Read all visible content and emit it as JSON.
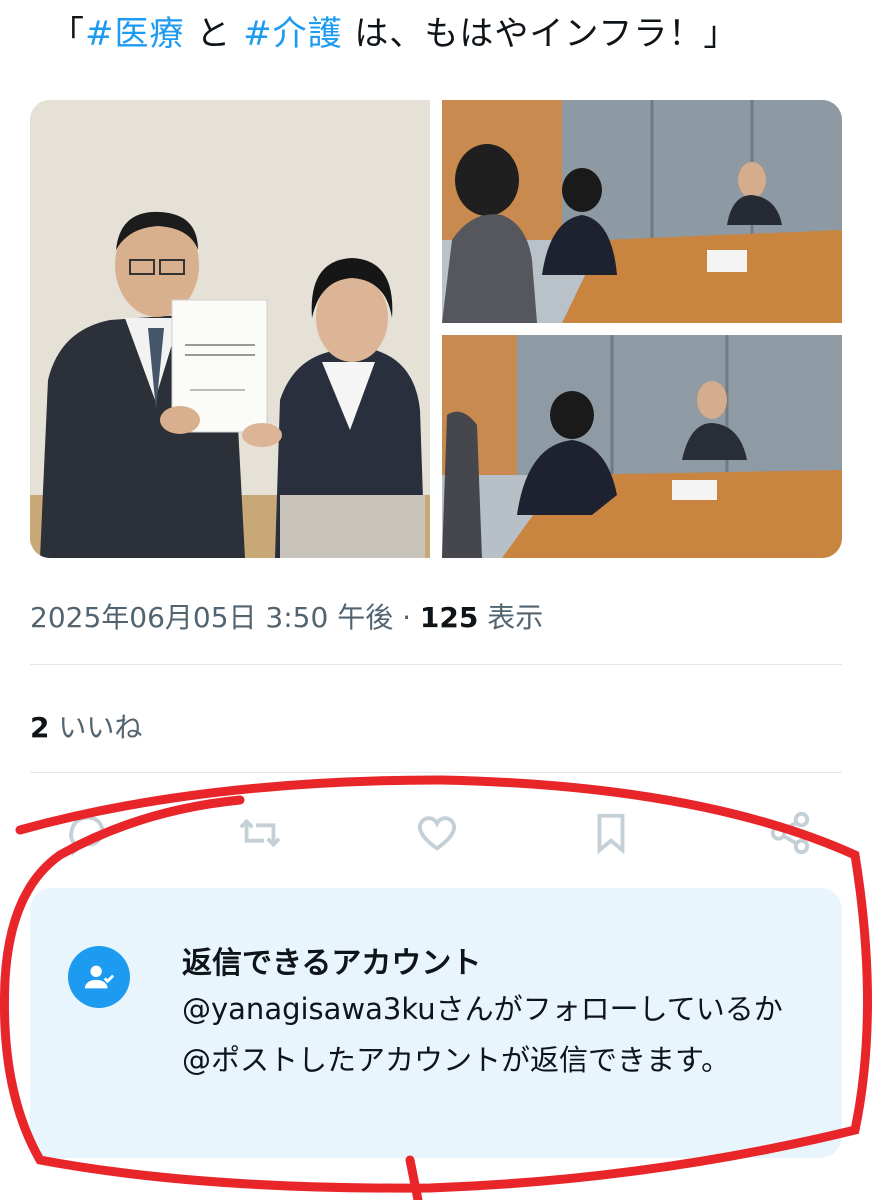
{
  "post": {
    "quote_open": "「",
    "hashtag1": "#医療",
    "connector": " と ",
    "hashtag2": "#介護",
    "rest": " は、もはやインフラ！」"
  },
  "meta": {
    "timestamp": "2025年06月05日 3:50 午後",
    "separator": " · ",
    "view_count": "125",
    "view_label": " 表示"
  },
  "likes": {
    "count": "2",
    "label": " いいね"
  },
  "actions": [
    "reply-icon",
    "retweet-icon",
    "like-icon",
    "bookmark-icon",
    "share-icon"
  ],
  "reply_card": {
    "title": "返信できるアカウント",
    "body": "@yanagisawa3kuさんがフォローしているか@ポストしたアカウントが返信できます。"
  },
  "colors": {
    "accent": "#1d9bf0",
    "text": "#0f1419",
    "muted": "#536471",
    "card_bg": "#e8f5fd",
    "annotation_red": "#e8262a"
  }
}
